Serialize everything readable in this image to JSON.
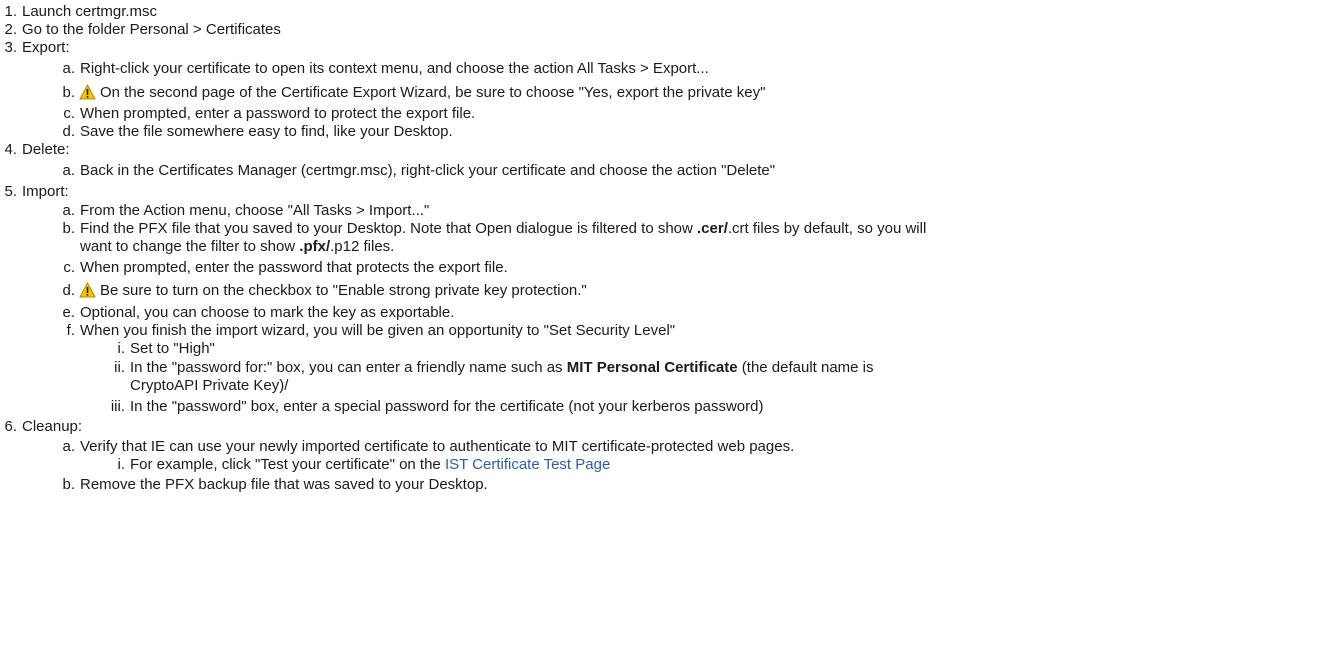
{
  "steps": [
    {
      "num": "1.",
      "text": "Launch certmgr.msc"
    },
    {
      "num": "2.",
      "text": "Go to the folder Personal > Certificates"
    },
    {
      "num": "3.",
      "text": "Export:",
      "sub": [
        {
          "num": "a.",
          "text": "Right-click your certificate to open its context menu, and choose the action All Tasks > Export..."
        },
        {
          "num": "b.",
          "warning": true,
          "text": "On the second page of the Certificate Export Wizard, be sure to choose \"Yes, export the private key\""
        },
        {
          "num": "c.",
          "text": "When prompted, enter a password to protect the export file."
        },
        {
          "num": "d.",
          "text": "Save the file somewhere easy to find, like your Desktop."
        }
      ]
    },
    {
      "num": "4.",
      "text": "Delete:",
      "sub": [
        {
          "num": "a.",
          "text": "Back in the Certificates Manager (certmgr.msc), right-click your certificate and choose the action \"Delete\""
        }
      ]
    },
    {
      "num": "5.",
      "text": "Import:",
      "sub": [
        {
          "num": "a.",
          "text": "From the Action menu, choose \"All Tasks > Import...\""
        },
        {
          "num": "b.",
          "text_parts": {
            "p1": "Find the PFX file that you saved to your Desktop. Note that Open dialogue is filtered to show ",
            "b1": ".cer/",
            "p2": ".crt files by default, so you will",
            "line2_p1": "want to change the filter to show ",
            "b2": ".pfx/",
            "line2_p2": ".p12 files."
          }
        },
        {
          "num": "c.",
          "text": "When prompted, enter the password that protects the export file."
        },
        {
          "num": "d.",
          "warning": true,
          "text": "Be sure to turn on the checkbox to \"Enable strong private key protection.\""
        },
        {
          "num": "e.",
          "text": "Optional, you can choose to mark the key as exportable."
        },
        {
          "num": "f.",
          "text": "When you finish the import wizard, you will be given an opportunity to \"Set Security Level\"",
          "sub": [
            {
              "num": "i.",
              "text": "Set to \"High\""
            },
            {
              "num": "ii.",
              "text_parts": {
                "p1": "In the \"password for:\" box, you can enter a friendly name such as ",
                "b1": "MIT Personal Certificate",
                "p2": " (the default name is",
                "line2": "CryptoAPI Private Key)/"
              }
            },
            {
              "num": "iii.",
              "text": "In the \"password\" box, enter a special password for the certificate (not your kerberos password)"
            }
          ]
        }
      ]
    },
    {
      "num": "6.",
      "text": "Cleanup:",
      "sub": [
        {
          "num": "a.",
          "text": "Verify that IE can use your newly imported certificate to authenticate to MIT certificate-protected web pages.",
          "sub": [
            {
              "num": "i.",
              "text_prefix": "For example, click \"Test your certificate\" on the ",
              "link_text": "IST Certificate Test Page"
            }
          ]
        },
        {
          "num": "b.",
          "text": "Remove the PFX backup file that was saved to your Desktop."
        }
      ]
    }
  ],
  "colors": {
    "link": "#2a5db0",
    "warning_fill": "#f5c400",
    "text": "#1b1b1b"
  },
  "icons": {
    "warning": "warning-icon"
  }
}
